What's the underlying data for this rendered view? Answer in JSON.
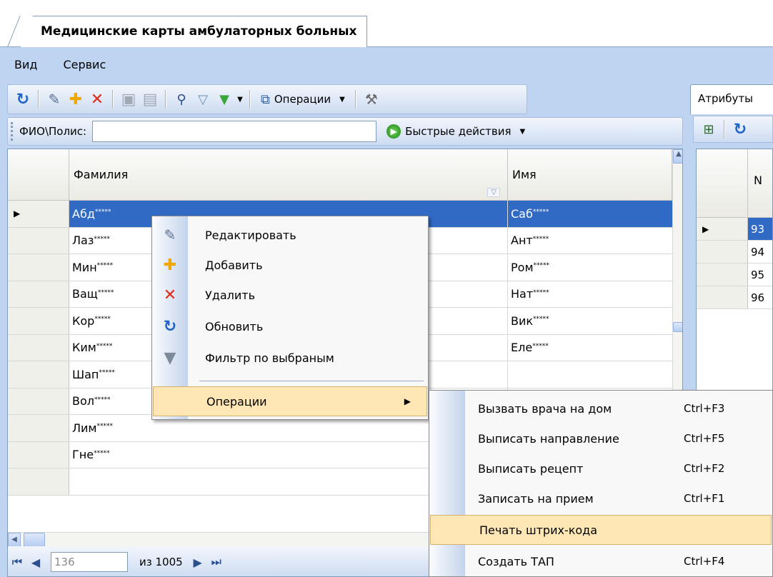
{
  "window": {
    "tab_title": "Медицинские карты амбулаторных больных"
  },
  "menubar": {
    "items": [
      "Вид",
      "Сервис"
    ]
  },
  "toolbar": {
    "operations_label": "Операции"
  },
  "search": {
    "label": "ФИО\\Полис:",
    "value": "",
    "quick_actions_label": "Быстрые действия"
  },
  "grid": {
    "columns": [
      "Фамилия",
      "Имя"
    ],
    "mask": "*****",
    "rows": [
      {
        "surname": "Абд",
        "name": "Саб"
      },
      {
        "surname": "Лаз",
        "name": "Ант"
      },
      {
        "surname": "Мин",
        "name": "Ром"
      },
      {
        "surname": "Ващ",
        "name": "Нат"
      },
      {
        "surname": "Кор",
        "name": "Вик"
      },
      {
        "surname": "Ким",
        "name": "Еле"
      },
      {
        "surname": "Шап",
        "name": ""
      },
      {
        "surname": "Вол",
        "name": ""
      },
      {
        "surname": "Лим",
        "name": ""
      },
      {
        "surname": "Гне",
        "name": ""
      },
      {
        "surname": "",
        "name": ""
      }
    ],
    "selected_row": 0
  },
  "navigator": {
    "position": "136",
    "total": "из 1005"
  },
  "right_panel": {
    "tab_label": "Атрибуты",
    "column_header": "N",
    "values": [
      "93",
      "94",
      "95",
      "96"
    ]
  },
  "context_menu": {
    "items": [
      "Редактировать",
      "Добавить",
      "Удалить",
      "Обновить",
      "Фильтр по выбраным"
    ],
    "operations_label": "Операции"
  },
  "submenu": {
    "items": [
      {
        "label": "Вызвать врача на дом",
        "shortcut": "Ctrl+F3"
      },
      {
        "label": "Выписать направление",
        "shortcut": "Ctrl+F5"
      },
      {
        "label": "Выписать рецепт",
        "shortcut": "Ctrl+F2"
      },
      {
        "label": "Записать на прием",
        "shortcut": "Ctrl+F1"
      },
      {
        "label": "Печать штрих-кода",
        "shortcut": ""
      },
      {
        "label": "Создать ТАП",
        "shortcut": "Ctrl+F4"
      }
    ],
    "highlighted_index": 4
  },
  "colors": {
    "panel_bg": "#bed4f0",
    "selection": "#316ac5",
    "menu_highlight": "#ffe7b5"
  }
}
